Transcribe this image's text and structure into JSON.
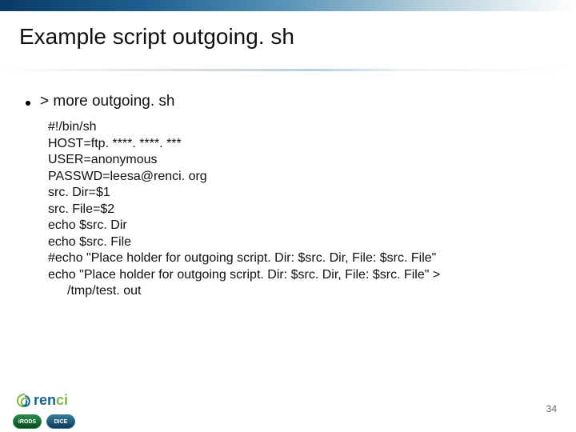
{
  "title": "Example script outgoing. sh",
  "bullet_prefix": ">",
  "bullet_text": "more outgoing. sh",
  "script": {
    "l1": "#!/bin/sh",
    "l2": "HOST=ftp. ****. ****. ***",
    "l3": "USER=anonymous",
    "l4": "PASSWD=leesa@renci. org",
    "l5": "src. Dir=$1",
    "l6": "src. File=$2",
    "l7": "echo $src. Dir",
    "l8": "echo $src. File",
    "l9": "#echo \"Place holder for outgoing script. Dir: $src. Dir, File: $src. File\"",
    "l10": "echo \"Place holder for outgoing script. Dir: $src. Dir, File: $src. File\" >",
    "l10b": "/tmp/test. out"
  },
  "footer": {
    "page_number": "34",
    "renci_text_a": "ren",
    "renci_text_b": "ci",
    "badge_irods": "iRODS",
    "badge_dice": "DICE"
  }
}
